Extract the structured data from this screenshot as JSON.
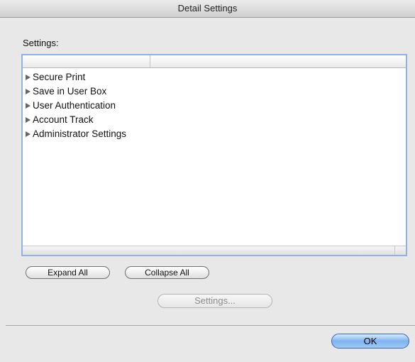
{
  "window": {
    "title": "Detail Settings"
  },
  "settings_label": "Settings:",
  "tree": {
    "items": [
      {
        "label": "Secure Print"
      },
      {
        "label": "Save in User Box"
      },
      {
        "label": "User Authentication"
      },
      {
        "label": "Account Track"
      },
      {
        "label": "Administrator Settings"
      }
    ]
  },
  "buttons": {
    "expand_all": "Expand All",
    "collapse_all": "Collapse All",
    "settings": "Settings...",
    "ok": "OK"
  },
  "icons": {
    "tree_expander": "disclosure-triangle-right-icon"
  },
  "colors": {
    "list_focus_border": "#8fb1e3",
    "default_button": "#7fb4ef"
  }
}
